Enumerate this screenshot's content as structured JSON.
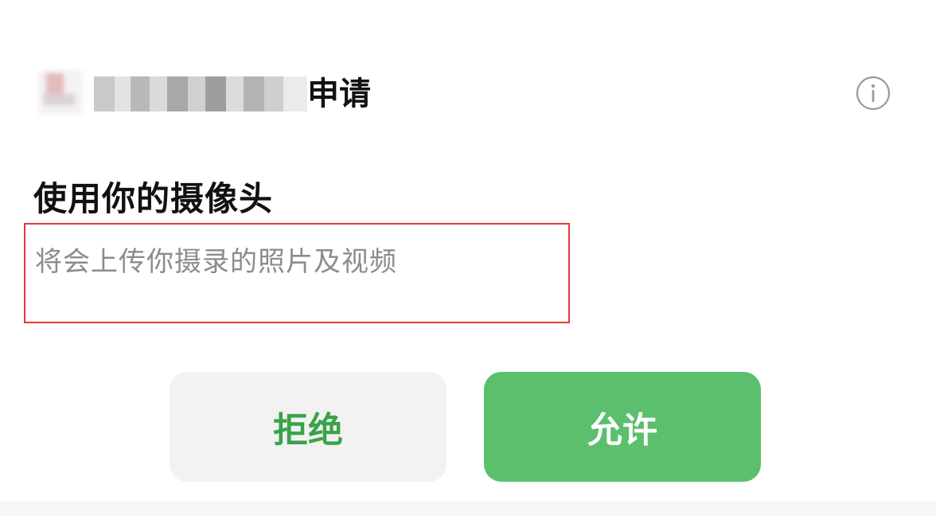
{
  "dialog": {
    "app_name": "██████████",
    "request_label": "申请",
    "info_icon": "info-circle-icon",
    "title": "使用你的摄像头",
    "description": "将会上传你摄录的照片及视频",
    "deny_label": "拒绝",
    "allow_label": "允许"
  },
  "colors": {
    "allow_bg": "#5bbf6d",
    "deny_bg": "#f2f2f2",
    "deny_text": "#3aa34a",
    "highlight_border": "#e53935",
    "description_text": "#8c8c8c"
  }
}
